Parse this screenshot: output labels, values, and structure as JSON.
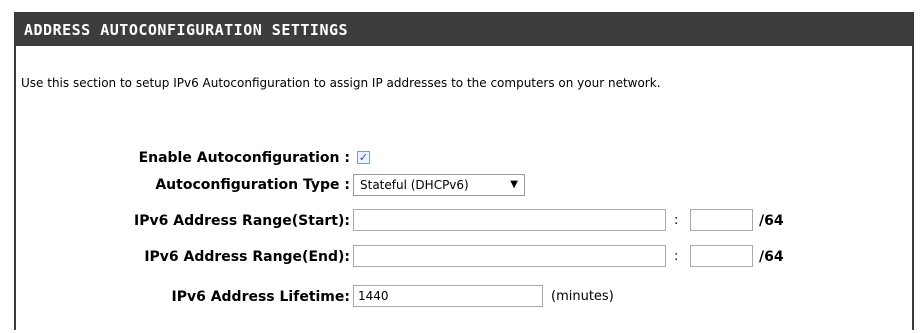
{
  "section": {
    "title": "ADDRESS AUTOCONFIGURATION SETTINGS",
    "description": "Use this section to setup IPv6 Autoconfiguration to assign IP addresses to the computers on your network."
  },
  "form": {
    "enable_autoconfig": {
      "label": "Enable Autoconfiguration :",
      "checked": true,
      "check_glyph": "✓"
    },
    "autoconfig_type": {
      "label": "Autoconfiguration Type :",
      "selected": "Stateful (DHCPv6)",
      "arrow_glyph": "▼"
    },
    "range_start": {
      "label": "IPv6 Address Range(Start):",
      "value": "",
      "tail_value": "",
      "separator": ":",
      "prefix": "/64"
    },
    "range_end": {
      "label": "IPv6 Address Range(End):",
      "value": "",
      "tail_value": "",
      "separator": ":",
      "prefix": "/64"
    },
    "lifetime": {
      "label": "IPv6 Address Lifetime:",
      "value": "1440",
      "units": "(minutes)"
    }
  },
  "colors": {
    "header_bg": "#3d3d3d",
    "header_text": "#ffffff",
    "border": "#3a3a3a"
  }
}
